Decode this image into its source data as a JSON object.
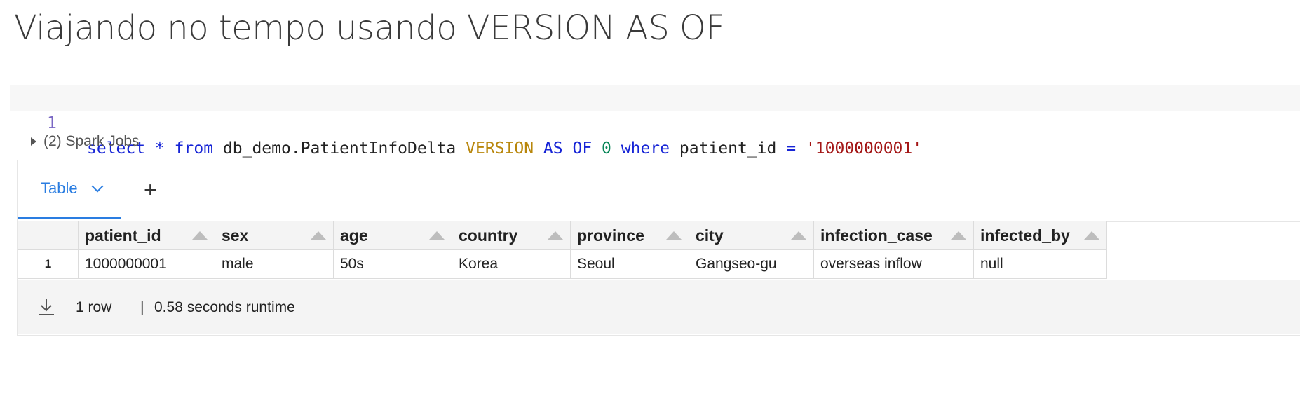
{
  "page": {
    "title": "Viajando no tempo usando VERSION AS OF"
  },
  "code": {
    "line_number": "1",
    "tokens": {
      "select": "select",
      "star": "*",
      "from": "from",
      "table": "db_demo.PatientInfoDelta",
      "version": "VERSION",
      "as": "AS",
      "of": "OF",
      "zero": "0",
      "where": "where",
      "column": "patient_id",
      "eq": "=",
      "value": "'1000000001'"
    }
  },
  "spark_jobs": {
    "label": "(2) Spark Jobs"
  },
  "result": {
    "tab_label": "Table",
    "add_tab_label": "+",
    "columns": [
      "patient_id",
      "sex",
      "age",
      "country",
      "province",
      "city",
      "infection_case",
      "infected_by"
    ],
    "rows": [
      {
        "index": "1",
        "cells": [
          "1000000001",
          "male",
          "50s",
          "Korea",
          "Seoul",
          "Gangseo-gu",
          "overseas inflow",
          "null"
        ]
      }
    ],
    "footer": {
      "rows": "1 row",
      "separator": "|",
      "runtime": "0.58 seconds runtime"
    }
  },
  "colors": {
    "accent": "#2a7de1",
    "keyword": "#1624d6",
    "string": "#a31515",
    "number": "#098658",
    "function": "#b8860b"
  }
}
